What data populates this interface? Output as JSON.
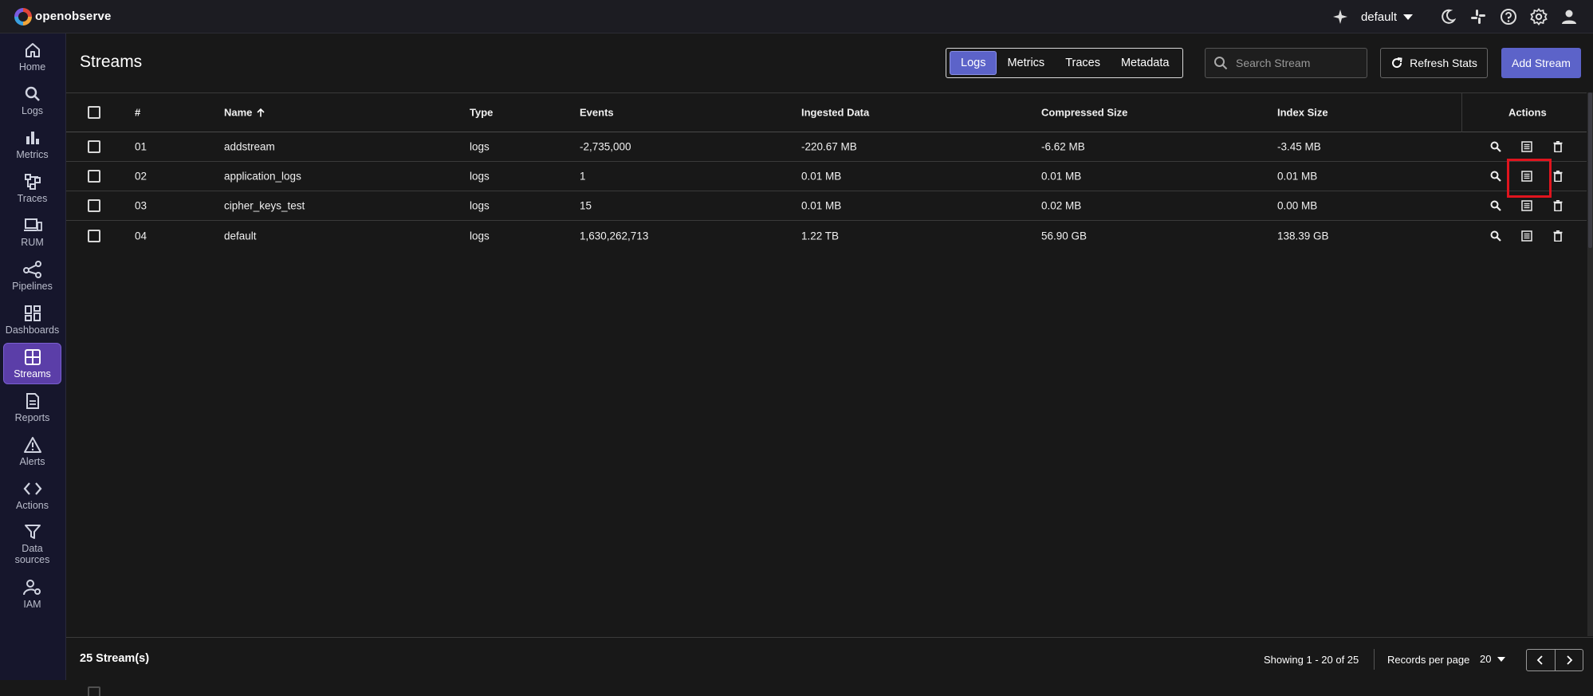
{
  "app": {
    "logo_text": "openobserve"
  },
  "header": {
    "org": "default",
    "icons": [
      "sparkle-icon",
      "moon-icon",
      "slack-icon",
      "help-icon",
      "settings-icon",
      "user-icon"
    ]
  },
  "sidebar": {
    "items": [
      {
        "label": "Home",
        "icon": "home-icon"
      },
      {
        "label": "Logs",
        "icon": "search-icon"
      },
      {
        "label": "Metrics",
        "icon": "bar-chart-icon"
      },
      {
        "label": "Traces",
        "icon": "traces-icon"
      },
      {
        "label": "RUM",
        "icon": "devices-icon"
      },
      {
        "label": "Pipelines",
        "icon": "pipeline-icon"
      },
      {
        "label": "Dashboards",
        "icon": "dashboard-icon"
      },
      {
        "label": "Streams",
        "icon": "streams-icon",
        "active": true
      },
      {
        "label": "Reports",
        "icon": "report-icon"
      },
      {
        "label": "Alerts",
        "icon": "alert-icon"
      },
      {
        "label": "Actions",
        "icon": "code-icon"
      },
      {
        "label": "Data sources",
        "icon": "filter-icon"
      },
      {
        "label": "IAM",
        "icon": "iam-icon"
      }
    ]
  },
  "page": {
    "title": "Streams",
    "tabs": [
      "Logs",
      "Metrics",
      "Traces",
      "Metadata"
    ],
    "active_tab": "Logs",
    "search_placeholder": "Search Stream",
    "refresh_label": "Refresh Stats",
    "add_label": "Add Stream"
  },
  "table": {
    "headers": {
      "num": "#",
      "name": "Name",
      "type": "Type",
      "events": "Events",
      "ingested": "Ingested Data",
      "compressed": "Compressed Size",
      "index": "Index Size",
      "actions": "Actions"
    },
    "rows": [
      {
        "num": "01",
        "name": "addstream",
        "type": "logs",
        "events": "-2,735,000",
        "ingested": "-220.67 MB",
        "compressed": "-6.62 MB",
        "index": "-3.45 MB"
      },
      {
        "num": "02",
        "name": "application_logs",
        "type": "logs",
        "events": "1",
        "ingested": "0.01 MB",
        "compressed": "0.01 MB",
        "index": "0.01 MB"
      },
      {
        "num": "03",
        "name": "cipher_keys_test",
        "type": "logs",
        "events": "15",
        "ingested": "0.01 MB",
        "compressed": "0.02 MB",
        "index": "0.00 MB"
      },
      {
        "num": "04",
        "name": "default",
        "type": "logs",
        "events": "1,630,262,713",
        "ingested": "1.22 TB",
        "compressed": "56.90 GB",
        "index": "138.39 GB"
      }
    ]
  },
  "footer": {
    "count": "25 Stream(s)",
    "showing": "Showing 1 - 20 of 25",
    "rpp_label": "Records per page",
    "rpp_value": "20"
  }
}
